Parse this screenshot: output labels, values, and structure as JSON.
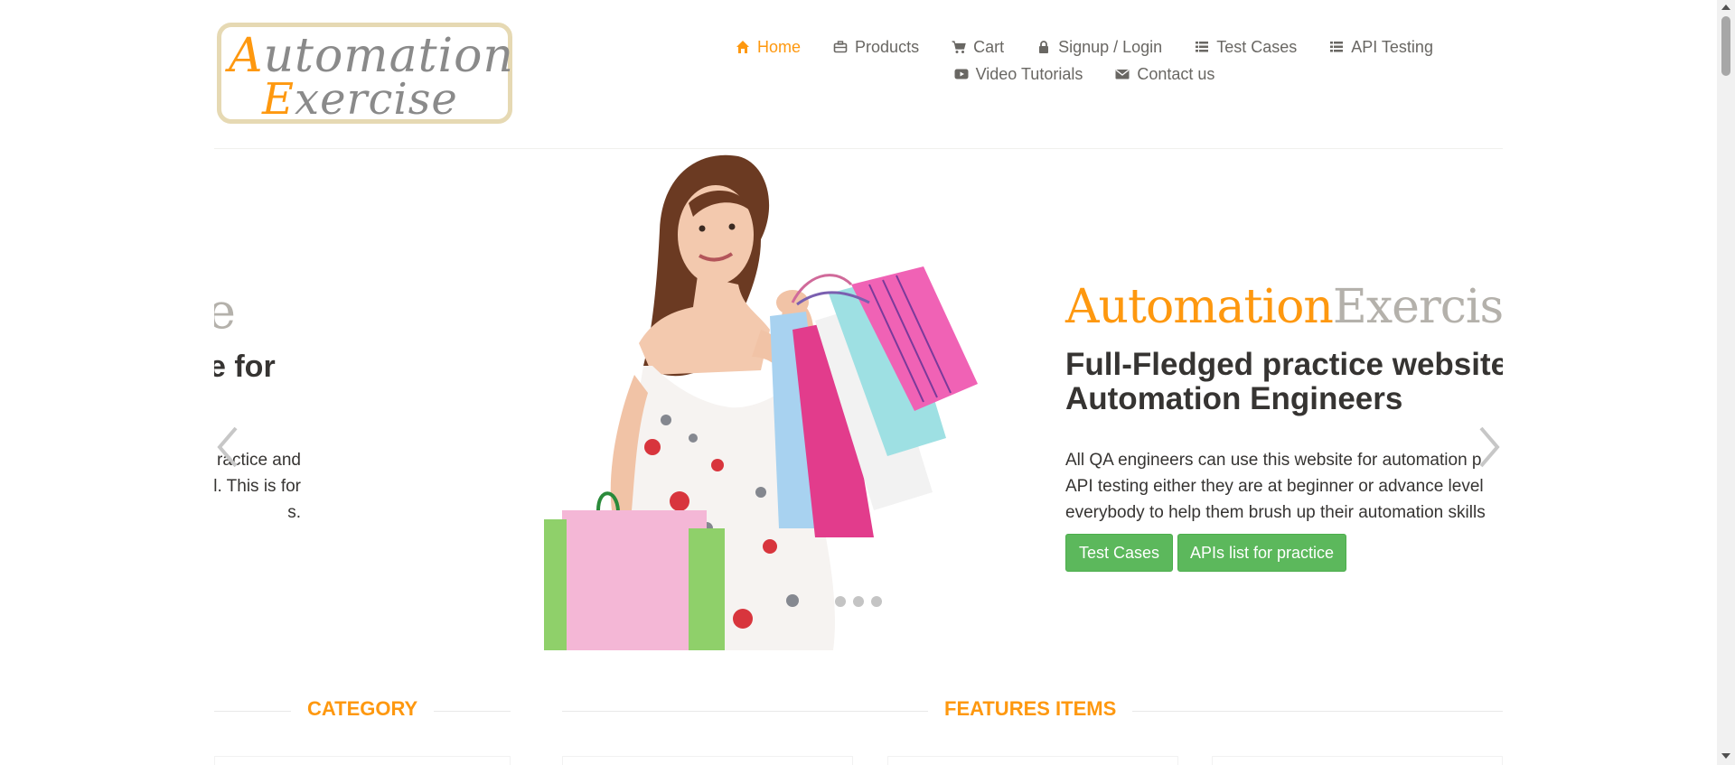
{
  "brand": {
    "line1_cap": "A",
    "line1_rest": "utomation",
    "line2_cap": "E",
    "line2_rest": "xercise"
  },
  "nav": {
    "row1": [
      {
        "label": "Home",
        "icon": "home-icon",
        "active": true
      },
      {
        "label": "Products",
        "icon": "briefcase-icon"
      },
      {
        "label": "Cart",
        "icon": "cart-icon"
      },
      {
        "label": "Signup / Login",
        "icon": "lock-icon"
      },
      {
        "label": "Test Cases",
        "icon": "list-icon"
      },
      {
        "label": "API Testing",
        "icon": "list-icon"
      }
    ],
    "row2": [
      {
        "label": "Video Tutorials",
        "icon": "youtube-icon"
      },
      {
        "label": "Contact us",
        "icon": "envelope-icon"
      }
    ]
  },
  "slider": {
    "ghost": {
      "title": "e",
      "headline": "e for",
      "lines": [
        "ractice and",
        "l. This is for",
        "s."
      ]
    },
    "title_a": "Automation",
    "title_b": "Exercise",
    "headline_1": "Full-Fledged practice website",
    "headline_2": "Automation Engineers",
    "desc_1": "All QA engineers can use this website for automation p",
    "desc_2": "API testing either they are at beginner or advance level",
    "desc_3": "everybody to help them brush up their automation skills",
    "btn_test_cases": "Test Cases",
    "btn_apis": "APIs list for practice",
    "slide_count": 3
  },
  "sections": {
    "category": "CATEGORY",
    "features": "FEATURES ITEMS"
  },
  "colors": {
    "accent": "#fe980f",
    "button": "#5cb85c",
    "text": "#363432",
    "muted": "#696763"
  }
}
